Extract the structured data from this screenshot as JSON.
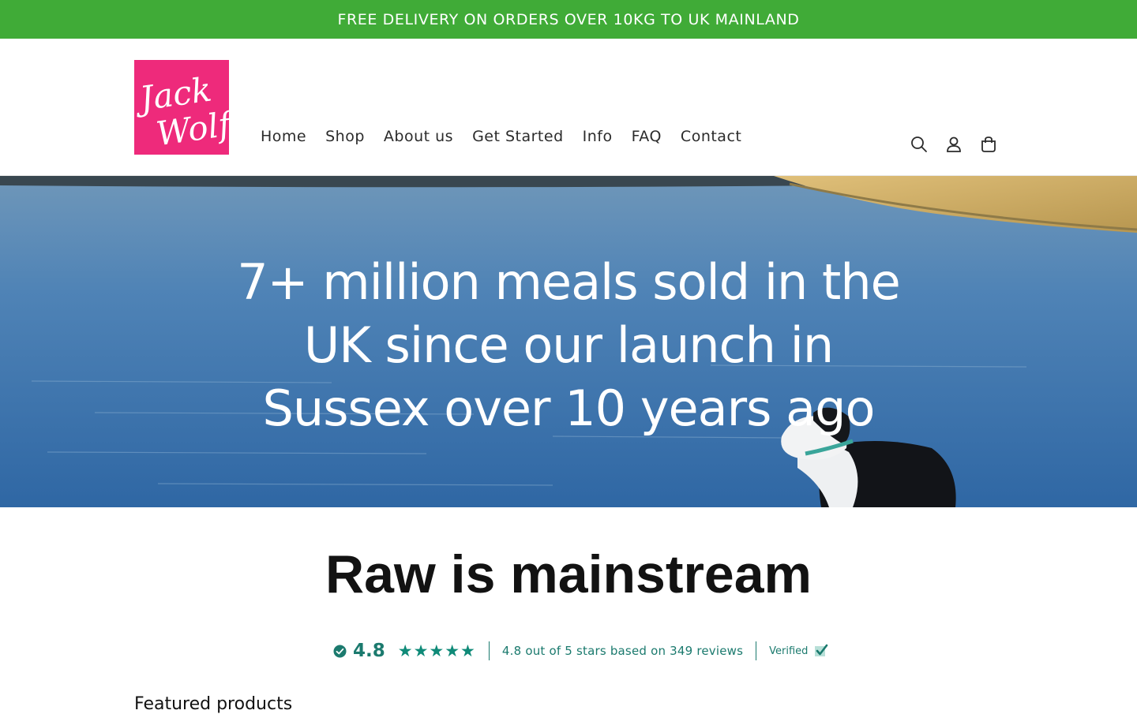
{
  "announcement": {
    "text": "FREE DELIVERY ON ORDERS OVER 10KG TO UK MAINLAND"
  },
  "header": {
    "logo": {
      "line1": "Jack",
      "line2": "Wolf",
      "color": "#ee2a7b"
    },
    "nav": [
      "Home",
      "Shop",
      "About us",
      "Get Started",
      "Info",
      "FAQ",
      "Contact"
    ],
    "icons": [
      "search-icon",
      "account-icon",
      "cart-icon"
    ]
  },
  "hero": {
    "headline": "7+ million meals sold in the UK since our launch in Sussex over 10 years ago"
  },
  "section": {
    "heading": "Raw is mainstream"
  },
  "reviews": {
    "score": "4.8",
    "stars": "★★★★★",
    "summary": "4.8 out of 5 stars based on 349 reviews",
    "verified": "Verified",
    "accent": "#1b7a6e"
  },
  "featured": {
    "title": "Featured products"
  },
  "colors": {
    "announcement_bg": "#40ab37",
    "logo_bg": "#ee2a7b"
  }
}
